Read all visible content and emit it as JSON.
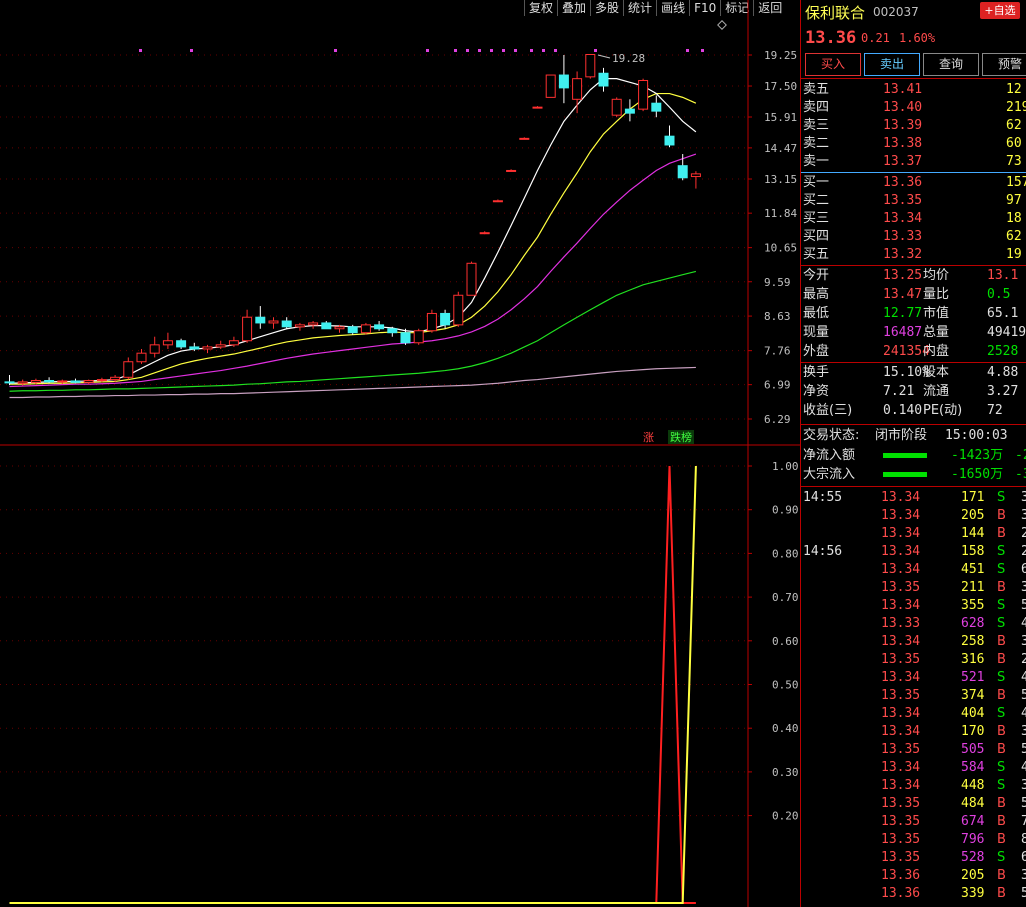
{
  "toolbar": [
    "复权",
    "叠加",
    "多股",
    "统计",
    "画线",
    "F10",
    "标记",
    "返回"
  ],
  "chart": {
    "price_ticks": [
      "19.25",
      "17.50",
      "15.91",
      "14.47",
      "13.15",
      "11.84",
      "10.65",
      "9.59",
      "8.63",
      "7.76",
      "6.99",
      "6.29"
    ],
    "ind_ticks": [
      "1.00",
      "0.90",
      "0.80",
      "0.70",
      "0.60",
      "0.50",
      "0.40",
      "0.30",
      "0.20"
    ],
    "high_label": "19.28",
    "tag_up": "涨",
    "tag_down": "跌榜"
  },
  "stock": {
    "name": "保利联合",
    "code": "002037",
    "add_label": "+自选",
    "price": "13.36",
    "change": "0.21",
    "pct": "1.60%",
    "buttons": [
      "买入",
      "卖出",
      "查询",
      "预警"
    ]
  },
  "orderbook": {
    "asks": [
      {
        "label": "卖五",
        "price": "13.41",
        "vol": "12"
      },
      {
        "label": "卖四",
        "price": "13.40",
        "vol": "219"
      },
      {
        "label": "卖三",
        "price": "13.39",
        "vol": "62"
      },
      {
        "label": "卖二",
        "price": "13.38",
        "vol": "60"
      },
      {
        "label": "卖一",
        "price": "13.37",
        "vol": "73"
      }
    ],
    "bids": [
      {
        "label": "买一",
        "price": "13.36",
        "vol": "157"
      },
      {
        "label": "买二",
        "price": "13.35",
        "vol": "97"
      },
      {
        "label": "买三",
        "price": "13.34",
        "vol": "18"
      },
      {
        "label": "买四",
        "price": "13.33",
        "vol": "62"
      },
      {
        "label": "买五",
        "price": "13.32",
        "vol": "19"
      }
    ]
  },
  "quote": [
    {
      "l1": "今开",
      "v1": "13.25",
      "l2": "均价",
      "v2": "13.1"
    },
    {
      "l1": "最高",
      "v1": "13.47",
      "l2": "量比",
      "v2": "0.5"
    },
    {
      "l1": "最低",
      "v1": "12.77",
      "l2": "市值",
      "v2": "65.1"
    },
    {
      "l1": "现量",
      "v1": "16487",
      "l2": "总量",
      "v2": "49419"
    },
    {
      "l1": "外盘",
      "v1": "241354",
      "l2": "内盘",
      "v2": "2528"
    }
  ],
  "finance": [
    {
      "l1": "换手",
      "v1": "15.10%",
      "l2": "股本",
      "v2": "4.88"
    },
    {
      "l1": "净资",
      "v1": "7.21",
      "l2": "流通",
      "v2": "3.27"
    },
    {
      "l1": "收益(三)",
      "v1": "0.140",
      "l2": "PE(动)",
      "v2": "72"
    }
  ],
  "status": {
    "label": "交易状态:",
    "value": "闭市阶段",
    "time": "15:00:03"
  },
  "flows": [
    {
      "label": "净流入额",
      "value": "-1423万",
      "tail": "-2"
    },
    {
      "label": "大宗流入",
      "value": "-1650万",
      "tail": "-3"
    }
  ],
  "ticks": [
    {
      "time": "14:55",
      "price": "13.34",
      "vol": "171",
      "side": "S",
      "tail": "3"
    },
    {
      "time": "",
      "price": "13.34",
      "vol": "205",
      "side": "B",
      "tail": "3"
    },
    {
      "time": "",
      "price": "13.34",
      "vol": "144",
      "side": "B",
      "tail": "2"
    },
    {
      "time": "14:56",
      "price": "13.34",
      "vol": "158",
      "side": "S",
      "tail": "2"
    },
    {
      "time": "",
      "price": "13.34",
      "vol": "451",
      "side": "S",
      "tail": "6"
    },
    {
      "time": "",
      "price": "13.35",
      "vol": "211",
      "side": "B",
      "tail": "3"
    },
    {
      "time": "",
      "price": "13.34",
      "vol": "355",
      "side": "S",
      "tail": "5"
    },
    {
      "time": "",
      "price": "13.33",
      "vol": "628",
      "side": "S",
      "tail": "4"
    },
    {
      "time": "",
      "price": "13.34",
      "vol": "258",
      "side": "B",
      "tail": "3"
    },
    {
      "time": "",
      "price": "13.35",
      "vol": "316",
      "side": "B",
      "tail": "2"
    },
    {
      "time": "",
      "price": "13.34",
      "vol": "521",
      "side": "S",
      "tail": "4"
    },
    {
      "time": "",
      "price": "13.35",
      "vol": "374",
      "side": "B",
      "tail": "5"
    },
    {
      "time": "",
      "price": "13.34",
      "vol": "404",
      "side": "S",
      "tail": "4"
    },
    {
      "time": "",
      "price": "13.34",
      "vol": "170",
      "side": "B",
      "tail": "3"
    },
    {
      "time": "",
      "price": "13.35",
      "vol": "505",
      "side": "B",
      "tail": "5"
    },
    {
      "time": "",
      "price": "13.34",
      "vol": "584",
      "side": "S",
      "tail": "4"
    },
    {
      "time": "",
      "price": "13.34",
      "vol": "448",
      "side": "S",
      "tail": "3"
    },
    {
      "time": "",
      "price": "13.35",
      "vol": "484",
      "side": "B",
      "tail": "5"
    },
    {
      "time": "",
      "price": "13.35",
      "vol": "674",
      "side": "B",
      "tail": "7"
    },
    {
      "time": "",
      "price": "13.35",
      "vol": "796",
      "side": "B",
      "tail": "8"
    },
    {
      "time": "",
      "price": "13.35",
      "vol": "528",
      "side": "S",
      "tail": "6"
    },
    {
      "time": "",
      "price": "13.36",
      "vol": "205",
      "side": "B",
      "tail": "3"
    },
    {
      "time": "",
      "price": "13.36",
      "vol": "339",
      "side": "B",
      "tail": "5"
    }
  ],
  "chart_data": {
    "type": "candlestick",
    "candles": [
      {
        "o": 7.05,
        "h": 7.2,
        "l": 6.98,
        "c": 7.03
      },
      {
        "o": 7.02,
        "h": 7.1,
        "l": 6.97,
        "c": 7.05
      },
      {
        "o": 7.04,
        "h": 7.12,
        "l": 7.0,
        "c": 7.08
      },
      {
        "o": 7.08,
        "h": 7.15,
        "l": 7.02,
        "c": 7.05
      },
      {
        "o": 7.05,
        "h": 7.1,
        "l": 7.0,
        "c": 7.07
      },
      {
        "o": 7.07,
        "h": 7.12,
        "l": 7.02,
        "c": 7.04
      },
      {
        "o": 7.04,
        "h": 7.1,
        "l": 7.0,
        "c": 7.08
      },
      {
        "o": 7.08,
        "h": 7.14,
        "l": 7.04,
        "c": 7.1
      },
      {
        "o": 7.1,
        "h": 7.2,
        "l": 7.05,
        "c": 7.15
      },
      {
        "o": 7.15,
        "h": 7.6,
        "l": 7.1,
        "c": 7.5
      },
      {
        "o": 7.5,
        "h": 7.8,
        "l": 7.45,
        "c": 7.7
      },
      {
        "o": 7.7,
        "h": 8.1,
        "l": 7.6,
        "c": 7.9
      },
      {
        "o": 7.9,
        "h": 8.2,
        "l": 7.8,
        "c": 8.0
      },
      {
        "o": 8.0,
        "h": 8.05,
        "l": 7.8,
        "c": 7.85
      },
      {
        "o": 7.85,
        "h": 7.95,
        "l": 7.75,
        "c": 7.8
      },
      {
        "o": 7.8,
        "h": 7.9,
        "l": 7.7,
        "c": 7.85
      },
      {
        "o": 7.85,
        "h": 8.0,
        "l": 7.8,
        "c": 7.9
      },
      {
        "o": 7.9,
        "h": 8.1,
        "l": 7.85,
        "c": 8.0
      },
      {
        "o": 8.0,
        "h": 8.8,
        "l": 7.95,
        "c": 8.6
      },
      {
        "o": 8.6,
        "h": 8.9,
        "l": 8.3,
        "c": 8.45
      },
      {
        "o": 8.45,
        "h": 8.6,
        "l": 8.3,
        "c": 8.5
      },
      {
        "o": 8.5,
        "h": 8.6,
        "l": 8.3,
        "c": 8.35
      },
      {
        "o": 8.35,
        "h": 8.45,
        "l": 8.25,
        "c": 8.4
      },
      {
        "o": 8.4,
        "h": 8.5,
        "l": 8.3,
        "c": 8.45
      },
      {
        "o": 8.45,
        "h": 8.5,
        "l": 8.3,
        "c": 8.3
      },
      {
        "o": 8.3,
        "h": 8.4,
        "l": 8.2,
        "c": 8.35
      },
      {
        "o": 8.35,
        "h": 8.4,
        "l": 8.15,
        "c": 8.2
      },
      {
        "o": 8.2,
        "h": 8.45,
        "l": 8.15,
        "c": 8.4
      },
      {
        "o": 8.4,
        "h": 8.5,
        "l": 8.25,
        "c": 8.3
      },
      {
        "o": 8.3,
        "h": 8.35,
        "l": 8.1,
        "c": 8.2
      },
      {
        "o": 8.2,
        "h": 8.3,
        "l": 7.9,
        "c": 7.95
      },
      {
        "o": 7.95,
        "h": 8.3,
        "l": 7.9,
        "c": 8.25
      },
      {
        "o": 8.25,
        "h": 8.8,
        "l": 8.2,
        "c": 8.7
      },
      {
        "o": 8.7,
        "h": 8.8,
        "l": 8.3,
        "c": 8.4
      },
      {
        "o": 8.4,
        "h": 9.3,
        "l": 8.35,
        "c": 9.2
      },
      {
        "o": 9.2,
        "h": 10.2,
        "l": 9.2,
        "c": 10.15
      },
      {
        "o": 11.15,
        "h": 11.2,
        "l": 11.1,
        "c": 11.15
      },
      {
        "o": 12.3,
        "h": 12.35,
        "l": 12.25,
        "c": 12.3
      },
      {
        "o": 13.5,
        "h": 13.55,
        "l": 13.45,
        "c": 13.5
      },
      {
        "o": 14.9,
        "h": 14.95,
        "l": 14.85,
        "c": 14.9
      },
      {
        "o": 16.4,
        "h": 16.45,
        "l": 16.35,
        "c": 16.4
      },
      {
        "o": 16.9,
        "h": 18.1,
        "l": 16.9,
        "c": 18.1
      },
      {
        "o": 18.1,
        "h": 19.25,
        "l": 16.6,
        "c": 17.4
      },
      {
        "o": 16.8,
        "h": 18.3,
        "l": 16.1,
        "c": 17.9
      },
      {
        "o": 18.0,
        "h": 19.28,
        "l": 17.9,
        "c": 19.28
      },
      {
        "o": 18.2,
        "h": 18.5,
        "l": 17.2,
        "c": 17.5
      },
      {
        "o": 16.0,
        "h": 16.9,
        "l": 15.9,
        "c": 16.8
      },
      {
        "o": 16.3,
        "h": 16.8,
        "l": 15.7,
        "c": 16.1
      },
      {
        "o": 16.3,
        "h": 17.9,
        "l": 16.2,
        "c": 17.8
      },
      {
        "o": 16.6,
        "h": 17.0,
        "l": 15.9,
        "c": 16.2
      },
      {
        "o": 15.0,
        "h": 15.5,
        "l": 14.5,
        "c": 14.6
      },
      {
        "o": 13.7,
        "h": 14.2,
        "l": 13.1,
        "c": 13.2
      },
      {
        "o": 13.25,
        "h": 13.47,
        "l": 12.77,
        "c": 13.36
      }
    ],
    "ma_white": [
      7.02,
      7.03,
      7.04,
      7.05,
      7.06,
      7.06,
      7.07,
      7.08,
      7.1,
      7.2,
      7.35,
      7.5,
      7.65,
      7.75,
      7.8,
      7.82,
      7.85,
      7.9,
      8.0,
      8.1,
      8.2,
      8.3,
      8.35,
      8.38,
      8.38,
      8.37,
      8.35,
      8.35,
      8.35,
      8.32,
      8.25,
      8.22,
      8.3,
      8.4,
      8.6,
      9.0,
      9.7,
      10.5,
      11.4,
      12.4,
      13.5,
      14.6,
      15.7,
      16.5,
      17.3,
      17.9,
      17.9,
      17.7,
      17.5,
      17.1,
      16.4,
      15.7,
      15.2
    ],
    "ma_yellow": [
      7.0,
      7.0,
      7.01,
      7.02,
      7.02,
      7.03,
      7.04,
      7.05,
      7.06,
      7.1,
      7.15,
      7.25,
      7.35,
      7.45,
      7.52,
      7.58,
      7.63,
      7.68,
      7.75,
      7.82,
      7.9,
      7.97,
      8.02,
      8.07,
      8.1,
      8.13,
      8.15,
      8.17,
      8.2,
      8.22,
      8.2,
      8.2,
      8.25,
      8.3,
      8.4,
      8.6,
      8.9,
      9.3,
      9.8,
      10.4,
      11.0,
      11.8,
      12.6,
      13.4,
      14.3,
      15.1,
      15.7,
      16.3,
      16.8,
      17.1,
      17.1,
      16.9,
      16.6
    ],
    "ma_purple": [
      6.95,
      6.96,
      6.97,
      6.98,
      6.99,
      7.0,
      7.0,
      7.01,
      7.02,
      7.04,
      7.06,
      7.1,
      7.14,
      7.18,
      7.22,
      7.26,
      7.3,
      7.35,
      7.4,
      7.46,
      7.52,
      7.58,
      7.63,
      7.68,
      7.72,
      7.76,
      7.8,
      7.84,
      7.88,
      7.92,
      7.94,
      7.97,
      8.0,
      8.05,
      8.12,
      8.22,
      8.36,
      8.55,
      8.8,
      9.1,
      9.45,
      9.9,
      10.35,
      10.8,
      11.3,
      11.8,
      12.25,
      12.7,
      13.1,
      13.5,
      13.8,
      14.0,
      14.2
    ],
    "ma_green": [
      6.85,
      6.86,
      6.86,
      6.87,
      6.87,
      6.88,
      6.88,
      6.89,
      6.9,
      6.9,
      6.91,
      6.92,
      6.93,
      6.94,
      6.95,
      6.96,
      6.97,
      6.98,
      7.0,
      7.01,
      7.03,
      7.05,
      7.06,
      7.08,
      7.1,
      7.12,
      7.14,
      7.16,
      7.18,
      7.2,
      7.22,
      7.24,
      7.27,
      7.3,
      7.34,
      7.4,
      7.48,
      7.58,
      7.7,
      7.85,
      8.0,
      8.2,
      8.4,
      8.6,
      8.8,
      9.0,
      9.2,
      9.35,
      9.5,
      9.6,
      9.7,
      9.8,
      9.9
    ],
    "ma_gray": [
      6.72,
      6.72,
      6.73,
      6.73,
      6.74,
      6.74,
      6.75,
      6.75,
      6.76,
      6.76,
      6.77,
      6.77,
      6.78,
      6.78,
      6.79,
      6.79,
      6.8,
      6.8,
      6.81,
      6.82,
      6.83,
      6.84,
      6.85,
      6.86,
      6.87,
      6.88,
      6.89,
      6.9,
      6.91,
      6.92,
      6.93,
      6.94,
      6.95,
      6.96,
      6.97,
      6.98,
      7.0,
      7.02,
      7.05,
      7.08,
      7.1,
      7.13,
      7.16,
      7.19,
      7.22,
      7.25,
      7.28,
      7.3,
      7.32,
      7.34,
      7.35,
      7.36,
      7.37
    ],
    "indicator_red": [
      0,
      0,
      0,
      0,
      0,
      0,
      0,
      0,
      0,
      0,
      0,
      0,
      0,
      0,
      0,
      0,
      0,
      0,
      0,
      0,
      0,
      0,
      0,
      0,
      0,
      0,
      0,
      0,
      0,
      0,
      0,
      0,
      0,
      0,
      0,
      0,
      0,
      0,
      0,
      0,
      0,
      0,
      0,
      0,
      0,
      0,
      0,
      0,
      0,
      0,
      1.0,
      0,
      0
    ],
    "indicator_yellow": [
      0,
      0,
      0,
      0,
      0,
      0,
      0,
      0,
      0,
      0,
      0,
      0,
      0,
      0,
      0,
      0,
      0,
      0,
      0,
      0,
      0,
      0,
      0,
      0,
      0,
      0,
      0,
      0,
      0,
      0,
      0,
      0,
      0,
      0,
      0,
      0,
      0,
      0,
      0,
      0,
      0,
      0,
      0,
      0,
      0,
      0,
      0,
      0,
      0,
      0,
      0,
      0,
      1.0
    ],
    "ylim": [
      6.29,
      19.25
    ]
  }
}
